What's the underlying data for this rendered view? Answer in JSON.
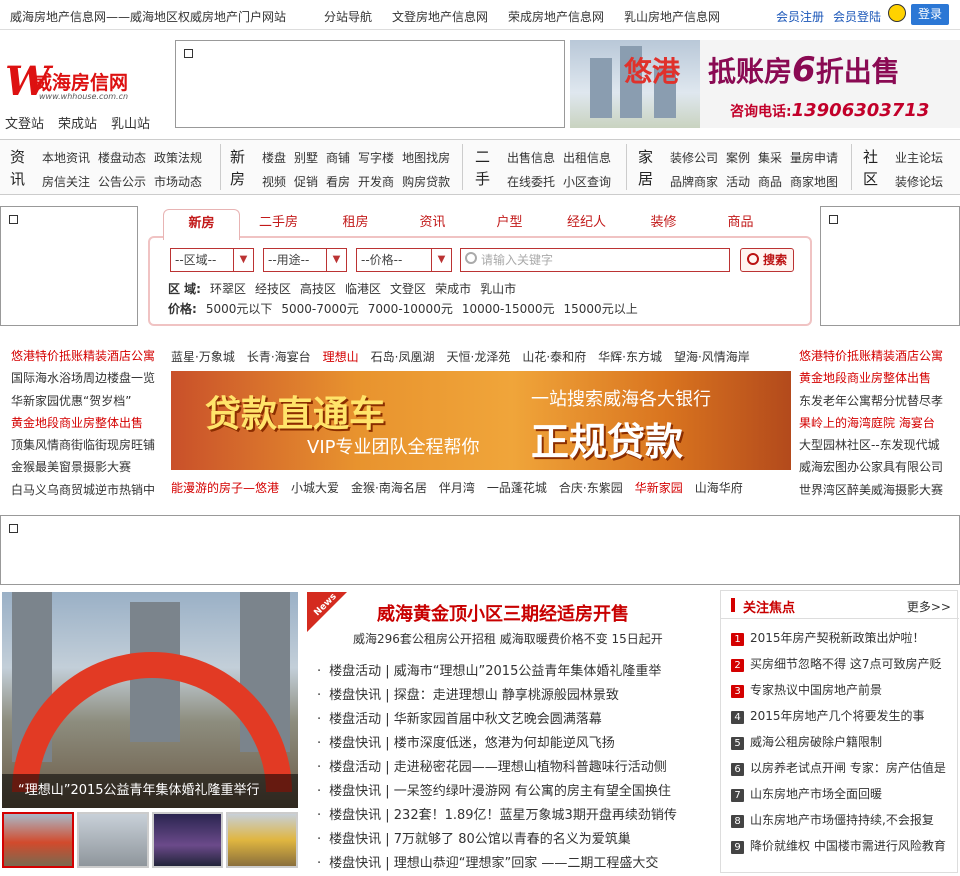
{
  "topbar": {
    "site_title": "威海房地产信息网——威海地区权威房地产门户网站",
    "links": [
      "分站导航",
      "文登房地产信息网",
      "荣成房地产信息网",
      "乳山房地产信息网"
    ],
    "register": "会员注册",
    "member_login": "会员登陆",
    "login_button": "登录"
  },
  "logo": {
    "mark": "W",
    "name": "威海房信网",
    "url": "www.whhouse.com.cn"
  },
  "stations": [
    "文登站",
    "荣成站",
    "乳山站"
  ],
  "banner_top": {
    "brand": "悠港",
    "text": "抵账房",
    "discount": "6",
    "text2": "折出售",
    "phone_label": "咨询电话:",
    "phone": "13906303713"
  },
  "nav": [
    {
      "cat": "资讯",
      "row1": [
        "本地资讯",
        "楼盘动态",
        "政策法规"
      ],
      "row2": [
        "房信关注",
        "公告公示",
        "市场动态"
      ]
    },
    {
      "cat": "新房",
      "row1": [
        "楼盘",
        "别墅",
        "商铺",
        "写字楼",
        "地图找房"
      ],
      "row2": [
        "视频",
        "促销",
        "看房",
        "开发商",
        "购房贷款"
      ]
    },
    {
      "cat": "二手",
      "row1": [
        "出售信息",
        "出租信息"
      ],
      "row2": [
        "在线委托",
        "小区查询"
      ]
    },
    {
      "cat": "家居",
      "row1": [
        "装修公司",
        "案例",
        "集采",
        "量房申请"
      ],
      "row2": [
        "品牌商家",
        "活动",
        "商品",
        "商家地图"
      ]
    },
    {
      "cat": "社区",
      "row1": [
        "业主论坛"
      ],
      "row2": [
        "装修论坛"
      ]
    }
  ],
  "search": {
    "tabs": [
      "新房",
      "二手房",
      "租房",
      "资讯",
      "户型",
      "经纪人",
      "装修",
      "商品"
    ],
    "active_tab": "新房",
    "district": "--区域--",
    "usage": "--用途--",
    "price": "--价格--",
    "keyword_placeholder": "请输入关键字",
    "button": "搜索",
    "district_label": "区 域:",
    "districts": [
      "环翠区",
      "经技区",
      "高技区",
      "临港区",
      "文登区",
      "荣成市",
      "乳山市"
    ],
    "price_label": "价格:",
    "prices": [
      "5000元以下",
      "5000-7000元",
      "7000-10000元",
      "10000-15000元",
      "15000元以上"
    ]
  },
  "promo": {
    "left": [
      {
        "text": "悠港特价抵账精装酒店公寓",
        "hl": true
      },
      {
        "text": "国际海水浴场周边楼盘一览",
        "hl": false
      },
      {
        "text": "华新家园优惠“贺岁档”",
        "hl": false
      },
      {
        "text": "黄金地段商业房整体出售",
        "hl": true
      },
      {
        "text": "顶集风情商街临街现房旺铺",
        "hl": false
      },
      {
        "text": "金猴最美窗景摄影大赛",
        "hl": false
      },
      {
        "text": "白马义乌商贸城逆市热销中",
        "hl": false
      }
    ],
    "top_row": [
      {
        "text": "蓝星·万象城",
        "hl": false
      },
      {
        "text": "长青·海宴台",
        "hl": false
      },
      {
        "text": "理想山",
        "hl": true
      },
      {
        "text": "石岛·凤凰湖",
        "hl": false
      },
      {
        "text": "天恒·龙泽苑",
        "hl": false
      },
      {
        "text": "山花·泰和府",
        "hl": false
      },
      {
        "text": "华辉·东方城",
        "hl": false
      },
      {
        "text": "望海·风情海岸",
        "hl": false
      }
    ],
    "bottom_row": [
      {
        "text": "能漫游的房子—悠港",
        "hl": true
      },
      {
        "text": "小城大爱",
        "hl": false
      },
      {
        "text": "金猴·南海名居",
        "hl": false
      },
      {
        "text": "伴月湾",
        "hl": false
      },
      {
        "text": "一品蓬花城",
        "hl": false
      },
      {
        "text": "合庆·东紫园",
        "hl": false
      },
      {
        "text": "华新家园",
        "hl": true
      },
      {
        "text": "山海华府",
        "hl": false
      }
    ],
    "right": [
      {
        "text": "悠港特价抵账精装酒店公寓",
        "hl": true
      },
      {
        "text": "黄金地段商业房整体出售",
        "hl": true
      },
      {
        "text": "东发老年公寓帮分忧替尽孝",
        "hl": false
      },
      {
        "text": "果岭上的海湾庭院 海宴台",
        "hl": true
      },
      {
        "text": "大型园林社区--东发现代城",
        "hl": false
      },
      {
        "text": "威海宏图办公家具有限公司",
        "hl": false
      },
      {
        "text": "世界湾区醉美威海摄影大赛",
        "hl": false
      }
    ],
    "banner": {
      "l1": "贷款直通车",
      "l2": "VIP专业团队全程帮你",
      "r1": "一站搜索威海各大银行",
      "r2": "正规贷款"
    }
  },
  "photo": {
    "caption": "“理想山”2015公益青年集体婚礼隆重举行"
  },
  "news": {
    "badge": "News",
    "headline": "威海黄金顶小区三期经适房开售",
    "subline": "威海296套公租房公开招租 威海取暖费价格不变 15日起开",
    "items": [
      "楼盘活动 | 威海市“理想山”2015公益青年集体婚礼隆重举",
      "楼盘快讯 | 探盘：走进理想山 静享桃源般园林景致",
      "楼盘活动 | 华新家园首届中秋文艺晚会圆满落幕",
      "楼盘快讯 | 楼市深度低迷，悠港为何却能逆风飞扬",
      "楼盘活动 | 走进秘密花园——理想山植物科普趣味行活动侧",
      "楼盘快讯 | 一呆签约绿叶漫游网 有公寓的房主有望全国换住",
      "楼盘快讯 | 232套！1.89亿！蓝星万象城3期开盘再续劲销传",
      "楼盘快讯 | 7万就够了 80公馆以青春的名义为爱筑巢",
      "楼盘快讯 | 理想山恭迎“理想家”回家 ——二期工程盛大交"
    ]
  },
  "focus": {
    "title": "关注焦点",
    "more": "更多>>",
    "items": [
      {
        "n": "1",
        "text": "2015年房产契税新政策出炉啦！"
      },
      {
        "n": "2",
        "text": "买房细节忽略不得 这7点可致房产贬"
      },
      {
        "n": "3",
        "text": "专家热议中国房地产前景"
      },
      {
        "n": "4",
        "text": "2015年房地产几个将要发生的事"
      },
      {
        "n": "5",
        "text": "威海公租房破除户籍限制"
      },
      {
        "n": "6",
        "text": "以房养老试点开闸 专家：房产估值是"
      },
      {
        "n": "7",
        "text": "山东房地产市场全面回暖"
      },
      {
        "n": "8",
        "text": "山东房地产市场僵持持续,不会报复"
      },
      {
        "n": "9",
        "text": "降价就维权 中国楼市需进行风险教育"
      }
    ]
  }
}
